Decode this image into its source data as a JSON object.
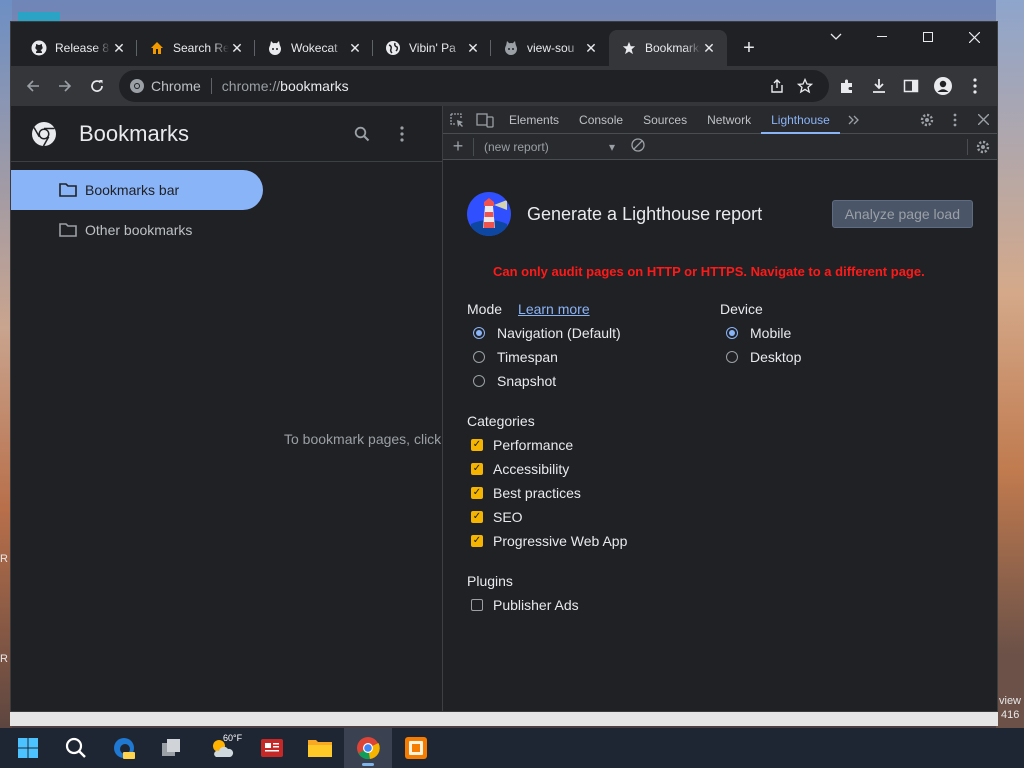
{
  "desktop": {
    "right_text_1": "view",
    "right_text_2": "416",
    "left_text_1": "R",
    "left_text_2": "R"
  },
  "tabs": [
    {
      "title": "Release 8",
      "icon": "github-icon"
    },
    {
      "title": "Search Re",
      "icon": "home-icon"
    },
    {
      "title": "Wokecat",
      "icon": "cat-icon"
    },
    {
      "title": "Vibin' Pa",
      "icon": "globe-icon"
    },
    {
      "title": "view-sou",
      "icon": "cat-icon"
    },
    {
      "title": "Bookmarks",
      "icon": "star-icon",
      "active": true
    }
  ],
  "omnibox": {
    "chip": "Chrome",
    "url_prefix": "chrome://",
    "url_host": "bookmarks"
  },
  "bookmarks": {
    "title": "Bookmarks",
    "folders": [
      "Bookmarks bar",
      "Other bookmarks"
    ],
    "empty_text": "To bookmark pages, click the star in the address bar"
  },
  "devtools": {
    "tabs": [
      "Elements",
      "Console",
      "Sources",
      "Network",
      "Lighthouse"
    ],
    "active_tab": "Lighthouse",
    "report_select": "(new report)"
  },
  "lighthouse": {
    "title": "Generate a Lighthouse report",
    "analyze_button": "Analyze page load",
    "warning": "Can only audit pages on HTTP or HTTPS. Navigate to a different page.",
    "mode_label": "Mode",
    "learn_more": "Learn more",
    "modes": [
      "Navigation (Default)",
      "Timespan",
      "Snapshot"
    ],
    "selected_mode": "Navigation (Default)",
    "device_label": "Device",
    "devices": [
      "Mobile",
      "Desktop"
    ],
    "selected_device": "Mobile",
    "categories_label": "Categories",
    "categories": [
      "Performance",
      "Accessibility",
      "Best practices",
      "SEO",
      "Progressive Web App"
    ],
    "plugins_label": "Plugins",
    "plugins": [
      "Publisher Ads"
    ]
  },
  "taskbar": {
    "weather": "60°F"
  },
  "colors": {
    "accent": "#8ab4f8",
    "warning": "#ff1a1a",
    "checkbox": "#f4b400"
  }
}
